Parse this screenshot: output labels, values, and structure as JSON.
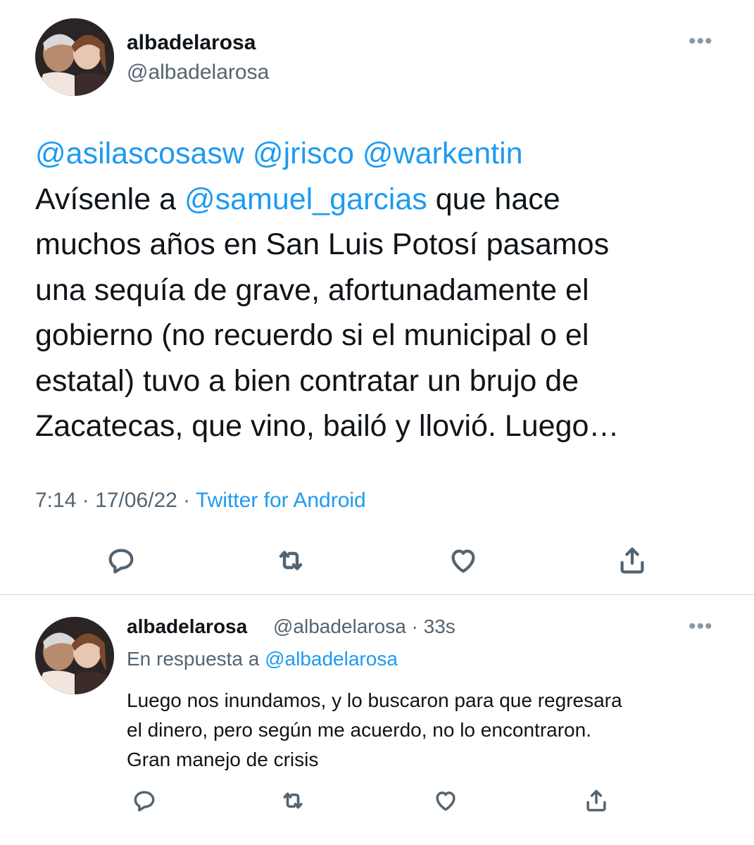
{
  "tweet": {
    "display_name": "albadelarosa",
    "handle": "@albadelarosa",
    "more_label": "•••",
    "text_lines": [
      [
        {
          "t": "@asilascosasw",
          "m": true
        },
        {
          "t": " ",
          "m": false
        },
        {
          "t": "@jrisco",
          "m": true
        },
        {
          "t": " ",
          "m": false
        },
        {
          "t": "@warkentin",
          "m": true
        }
      ],
      [
        {
          "t": "Avísenle a ",
          "m": false
        },
        {
          "t": "@samuel_garcias",
          "m": true
        },
        {
          "t": " que hace",
          "m": false
        }
      ],
      [
        {
          "t": "muchos años en San Luis Potosí pasamos",
          "m": false
        }
      ],
      [
        {
          "t": "una sequía de grave, afortunadamente el",
          "m": false
        }
      ],
      [
        {
          "t": "gobierno (no recuerdo si el municipal o el",
          "m": false
        }
      ],
      [
        {
          "t": "estatal) tuvo a bien contratar un brujo de",
          "m": false
        }
      ],
      [
        {
          "t": "Zacatecas, que vino, bailó y llovió. Luego…",
          "m": false
        }
      ]
    ],
    "time": "7:14",
    "separator": " · ",
    "date": "17/06/22",
    "source": "Twitter for Android"
  },
  "reply": {
    "display_name": "albadelarosa",
    "meta": "@albadelarosa · 33s",
    "more_label": "•••",
    "context_prefix": "En respuesta a ",
    "context_mention": "@albadelarosa",
    "text": "Luego nos inundamos, y lo buscaron para que regresara\nel dinero, pero según me acuerdo, no lo encontraron.\nGran manejo de crisis"
  },
  "icons": {
    "reply": "reply-icon",
    "retweet": "retweet-icon",
    "like": "like-icon",
    "share": "share-icon",
    "more": "more-icon"
  },
  "colors": {
    "accent": "#1d9bf0",
    "secondary_text": "#536471",
    "text": "#0f1419",
    "divider": "#cfd9de"
  }
}
